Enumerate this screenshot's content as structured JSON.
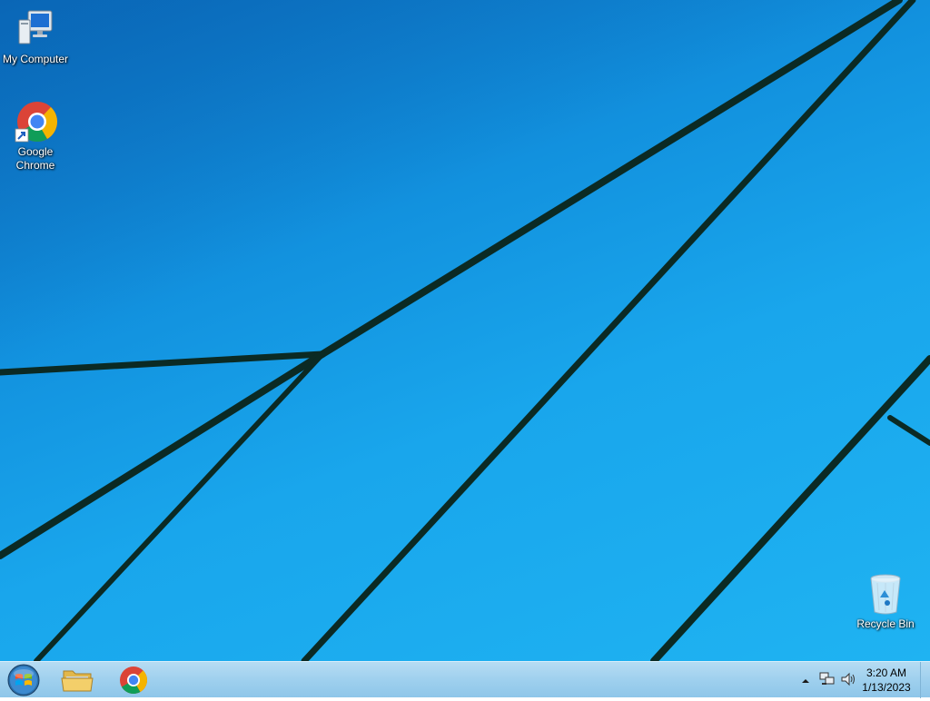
{
  "desktop": {
    "icons": [
      {
        "label": "My Computer",
        "icon": "computer-icon"
      },
      {
        "label": "Google Chrome",
        "icon": "chrome-icon"
      },
      {
        "label": "Recycle Bin",
        "icon": "recycle-bin-icon"
      }
    ]
  },
  "taskbar": {
    "start_icon": "windows-orb-icon",
    "pinned": [
      {
        "name": "File Explorer",
        "icon": "folder-icon"
      },
      {
        "name": "Google Chrome",
        "icon": "chrome-icon"
      }
    ],
    "tray": {
      "icons": [
        "show-hidden-icons-icon",
        "network-icon",
        "volume-icon"
      ],
      "time": "3:20 AM",
      "date": "1/13/2023"
    }
  },
  "colors": {
    "wallpaper_blue": "#1aa3ea",
    "wallpaper_dark": "#0a6fc0",
    "taskbar": "#a6d4ef",
    "lines": "#0b2a24"
  }
}
